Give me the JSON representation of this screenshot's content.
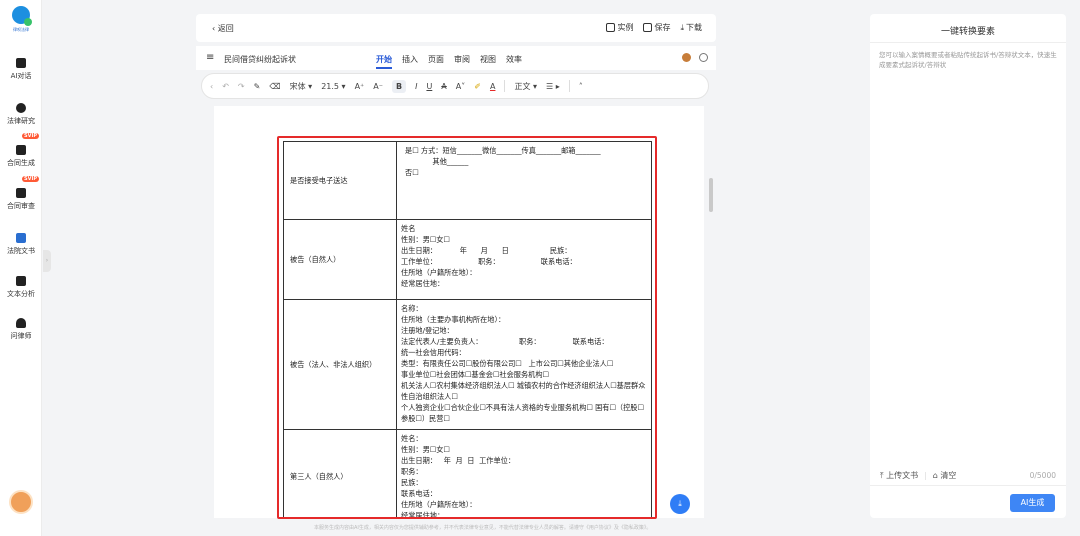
{
  "app": {
    "logo_text": "律呗法律"
  },
  "sidebar": {
    "items": [
      {
        "label": "AI对话",
        "icon": "chat-icon"
      },
      {
        "label": "法律研究",
        "icon": "research-icon",
        "badge": "SVIP"
      },
      {
        "label": "合同生成",
        "icon": "contract-gen-icon",
        "badge": "SVIP"
      },
      {
        "label": "合同审查",
        "icon": "contract-review-icon"
      },
      {
        "label": "法院文书",
        "icon": "court-doc-icon"
      },
      {
        "label": "文本分析",
        "icon": "text-analysis-icon"
      },
      {
        "label": "问律师",
        "icon": "lawyer-icon"
      }
    ]
  },
  "topbar": {
    "back_label": "返回",
    "example_label": "实例",
    "save_label": "保存",
    "download_label": "下载"
  },
  "editor": {
    "doc_title": "民间借贷纠纷起诉状",
    "tabs": [
      "开始",
      "插入",
      "页面",
      "审阅",
      "视图",
      "效率"
    ],
    "active_tab": "开始",
    "toolbar": {
      "font_family": "宋体",
      "font_size": "21.5",
      "paragraph_style": "正文"
    }
  },
  "form_rows": [
    {
      "label": "是否接受电子送达",
      "lines": [
        "是☐ 方式：短信_______微信_______传真_______邮箱_______",
        "            其他______",
        "否☐"
      ]
    },
    {
      "label": "被告（自然人）",
      "lines": [
        "姓名",
        "性别：男☐女☐",
        "出生日期：          年      月      日                  民族：",
        "工作单位：                  职务：                  联系电话：",
        "住所地（户籍所在地）：",
        "经常居住地："
      ]
    },
    {
      "label": "被告（法人、非法人组织）",
      "lines": [
        "名称：",
        "住所地（主要办事机构所在地）：",
        "注册地/登记地：",
        "法定代表人/主要负责人：                职务：              联系电话：",
        "统一社会信用代码：",
        "类型：有限责任公司☐股份有限公司☐   上市公司☐其他企业法人☐",
        "事业单位☐社会团体☐基金会☐社会服务机构☐",
        "机关法人☐农村集体经济组织法人☐   城镇农村的合作经济组织法人☐基层群众性自治组织法人☐",
        "个人独资企业☐合伙企业☐不具有法人资格的专业服务机构☐ 国有☐（控股☐参股☐）民营☐"
      ]
    },
    {
      "label": "第三人（自然人）",
      "lines": [
        "姓名：",
        "性别：男☐女☐",
        "出生日期：   年  月  日  工作单位：",
        "职务：",
        "民族：",
        "联系电话：",
        "住所地（户籍所在地）：",
        "经常居住地："
      ]
    }
  ],
  "disclaimer": "本服务生成内容由AI生成，相关内容仅为您提供辅助参考，并不代表法律专业意见，不能代替法律专业人员的解答。请遵守《用户协议》及《隐私政策》。",
  "right_panel": {
    "title": "一键转换要素",
    "placeholder": "您可以输入案情概要或者粘贴传统起诉书/答辩状文本，快速生成要素式起诉状/答辩状",
    "upload_label": "上传文书",
    "clear_label": "清空",
    "char_count": "0/5000",
    "generate_label": "AI生成"
  },
  "colors": {
    "accent": "#2a5bd7",
    "highlight": "#e52a2a",
    "button": "#3e86f5"
  }
}
